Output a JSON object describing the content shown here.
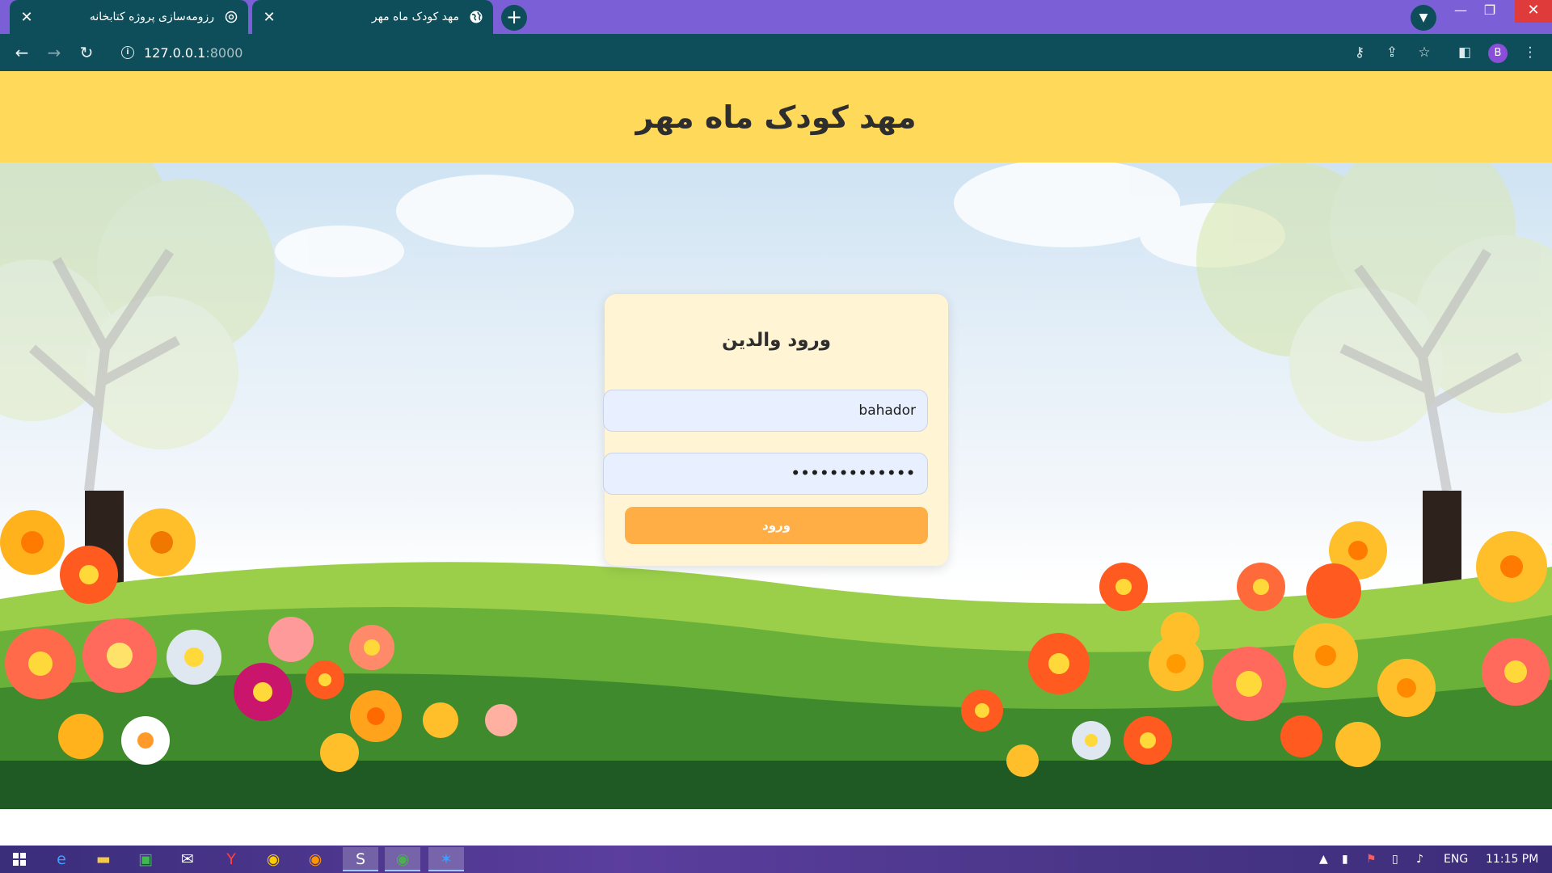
{
  "browser": {
    "tabs": [
      {
        "title": "رزومه‌سازی پروژه کتابخانه",
        "icon": "chatgpt-icon"
      },
      {
        "title": "مهد کودک ماه مهر",
        "icon": "globe-icon"
      }
    ],
    "address": {
      "host": "127.0.0.1",
      "port": ":8000"
    },
    "profile_initial": "B"
  },
  "page": {
    "site_title": "مهد کودک ماه مهر",
    "login": {
      "title": "ورود والدین",
      "username_value": "bahador",
      "password_value": "•••••••••••••",
      "submit_label": "ورود"
    }
  },
  "taskbar": {
    "language": "ENG",
    "time": "11:15 PM"
  },
  "colors": {
    "tabstrip": "#7b5fd6",
    "toolbar": "#0e4e5a",
    "header": "#ffd95a",
    "card": "#fff4d4",
    "button": "#ffae45"
  }
}
